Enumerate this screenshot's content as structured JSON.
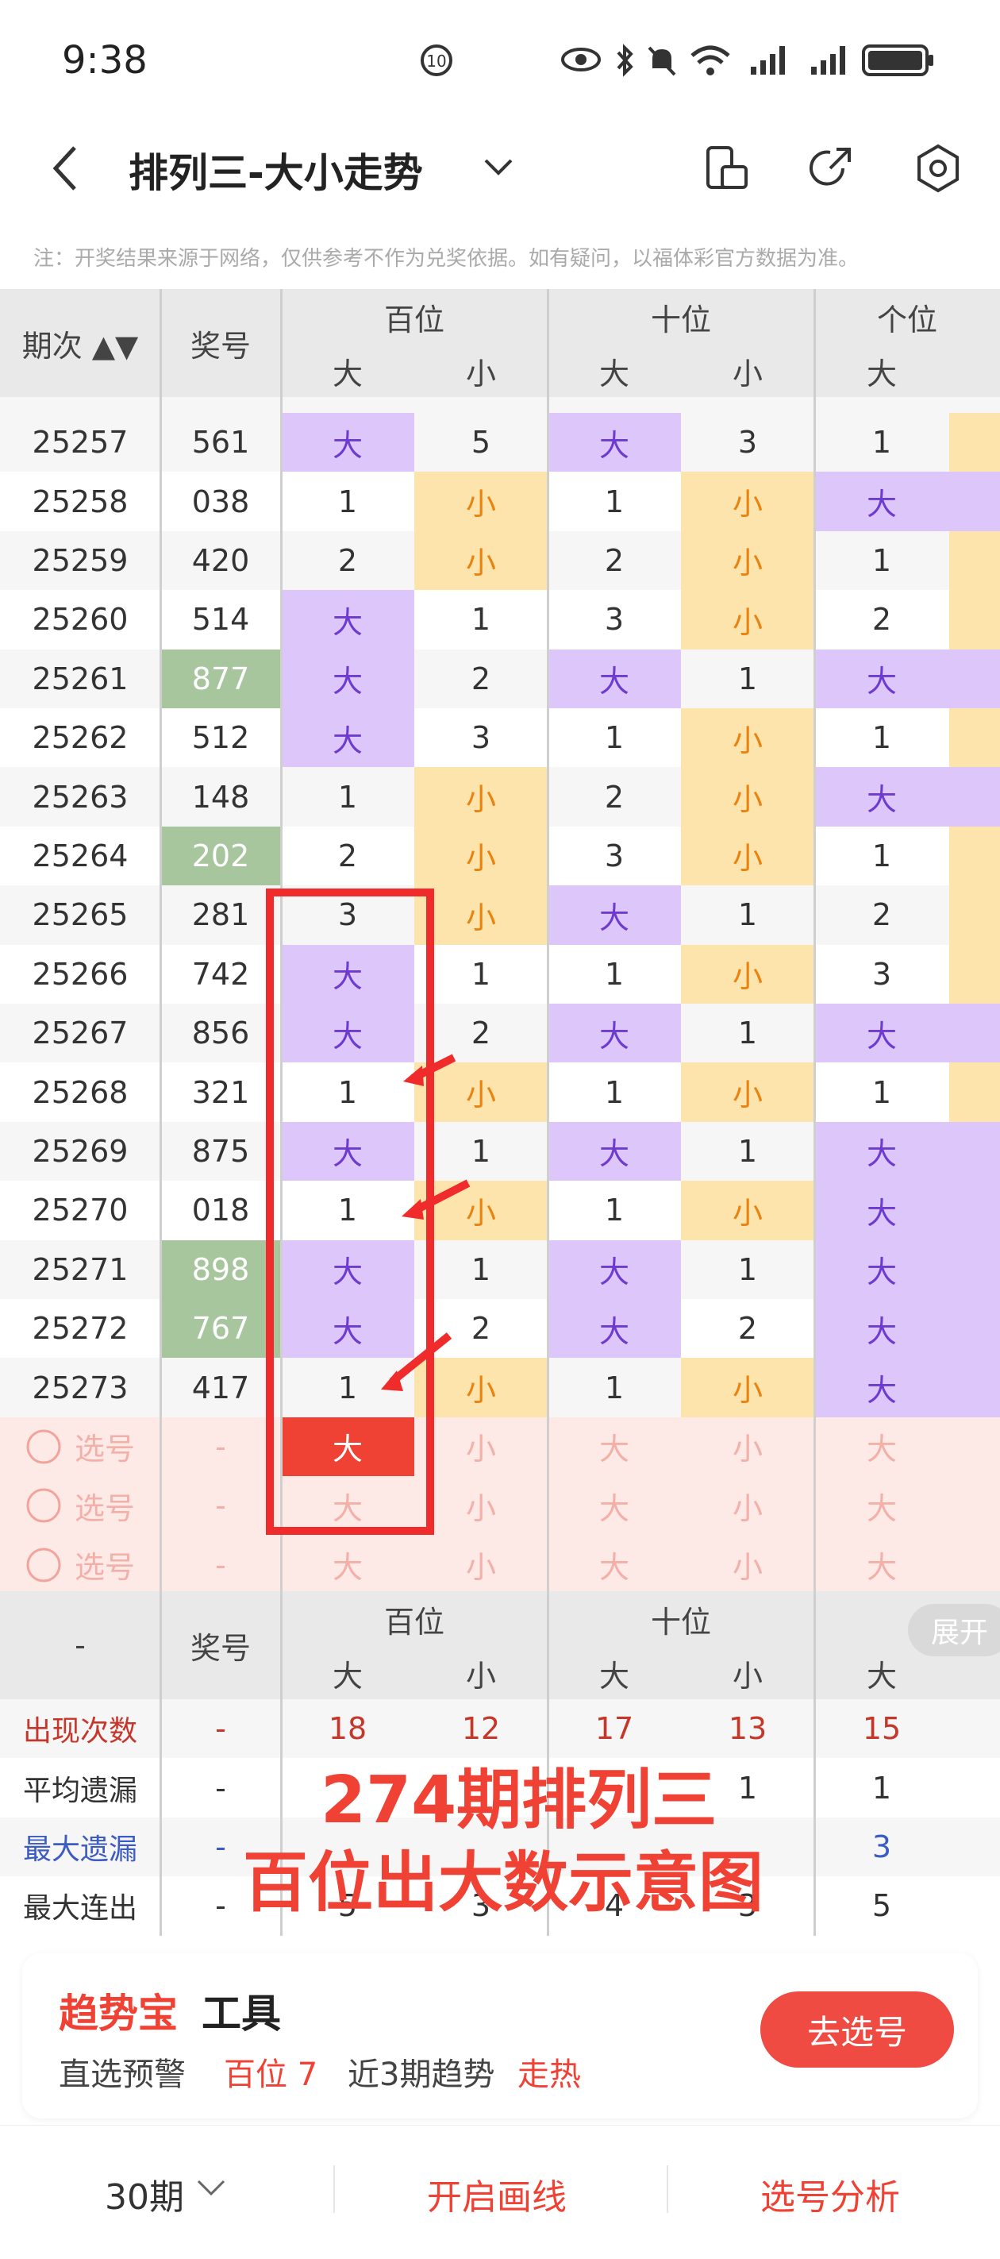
{
  "status_bar": {
    "time": "9:38"
  },
  "nav": {
    "title": "排列三-大小走势"
  },
  "notice": "注：开奖结果来源于网络，仅供参考不作为兑奖依据。如有疑问，以福体彩官方数据为准。",
  "table": {
    "col_issue": "期次",
    "col_award": "奖号",
    "groups": [
      "百位",
      "十位",
      "个位"
    ],
    "big": "大",
    "small": "小",
    "rows": [
      {
        "issue": "25257",
        "award": "561",
        "c": [
          "大",
          "5",
          "大",
          "3",
          "1"
        ],
        "t": [
          "b",
          "n",
          "b",
          "n",
          "n"
        ],
        "g": false
      },
      {
        "issue": "25258",
        "award": "038",
        "c": [
          "1",
          "小",
          "1",
          "小",
          "大"
        ],
        "t": [
          "n",
          "s",
          "n",
          "s",
          "b"
        ],
        "g": false
      },
      {
        "issue": "25259",
        "award": "420",
        "c": [
          "2",
          "小",
          "2",
          "小",
          "1"
        ],
        "t": [
          "n",
          "s",
          "n",
          "s",
          "n"
        ],
        "g": false
      },
      {
        "issue": "25260",
        "award": "514",
        "c": [
          "大",
          "1",
          "3",
          "小",
          "2"
        ],
        "t": [
          "b",
          "n",
          "n",
          "s",
          "n"
        ],
        "g": false
      },
      {
        "issue": "25261",
        "award": "877",
        "c": [
          "大",
          "2",
          "大",
          "1",
          "大"
        ],
        "t": [
          "b",
          "n",
          "b",
          "n",
          "b"
        ],
        "g": true
      },
      {
        "issue": "25262",
        "award": "512",
        "c": [
          "大",
          "3",
          "1",
          "小",
          "1"
        ],
        "t": [
          "b",
          "n",
          "n",
          "s",
          "n"
        ],
        "g": false
      },
      {
        "issue": "25263",
        "award": "148",
        "c": [
          "1",
          "小",
          "2",
          "小",
          "大"
        ],
        "t": [
          "n",
          "s",
          "n",
          "s",
          "b"
        ],
        "g": false
      },
      {
        "issue": "25264",
        "award": "202",
        "c": [
          "2",
          "小",
          "3",
          "小",
          "1"
        ],
        "t": [
          "n",
          "s",
          "n",
          "s",
          "n"
        ],
        "g": true
      },
      {
        "issue": "25265",
        "award": "281",
        "c": [
          "3",
          "小",
          "大",
          "1",
          "2"
        ],
        "t": [
          "n",
          "s",
          "b",
          "n",
          "n"
        ],
        "g": false
      },
      {
        "issue": "25266",
        "award": "742",
        "c": [
          "大",
          "1",
          "1",
          "小",
          "3"
        ],
        "t": [
          "b",
          "n",
          "n",
          "s",
          "n"
        ],
        "g": false
      },
      {
        "issue": "25267",
        "award": "856",
        "c": [
          "大",
          "2",
          "大",
          "1",
          "大"
        ],
        "t": [
          "b",
          "n",
          "b",
          "n",
          "b"
        ],
        "g": false
      },
      {
        "issue": "25268",
        "award": "321",
        "c": [
          "1",
          "小",
          "1",
          "小",
          "1"
        ],
        "t": [
          "n",
          "s",
          "n",
          "s",
          "n"
        ],
        "g": false
      },
      {
        "issue": "25269",
        "award": "875",
        "c": [
          "大",
          "1",
          "大",
          "1",
          "大"
        ],
        "t": [
          "b",
          "n",
          "b",
          "n",
          "b"
        ],
        "g": false
      },
      {
        "issue": "25270",
        "award": "018",
        "c": [
          "1",
          "小",
          "1",
          "小",
          "大"
        ],
        "t": [
          "n",
          "s",
          "n",
          "s",
          "b"
        ],
        "g": false
      },
      {
        "issue": "25271",
        "award": "898",
        "c": [
          "大",
          "1",
          "大",
          "1",
          "大"
        ],
        "t": [
          "b",
          "n",
          "b",
          "n",
          "b"
        ],
        "g": true
      },
      {
        "issue": "25272",
        "award": "767",
        "c": [
          "大",
          "2",
          "大",
          "2",
          "大"
        ],
        "t": [
          "b",
          "n",
          "b",
          "n",
          "b"
        ],
        "g": true
      },
      {
        "issue": "25273",
        "award": "417",
        "c": [
          "1",
          "小",
          "1",
          "小",
          "大"
        ],
        "t": [
          "n",
          "s",
          "n",
          "s",
          "b"
        ],
        "g": false
      }
    ],
    "pick_rows": [
      {
        "label": "选号",
        "dash": "-",
        "c": [
          "大",
          "小",
          "大",
          "小",
          "大"
        ]
      },
      {
        "label": "选号",
        "dash": "-",
        "c": [
          "大",
          "小",
          "大",
          "小",
          "大"
        ]
      },
      {
        "label": "选号",
        "dash": "-",
        "c": [
          "大",
          "小",
          "大",
          "小",
          "大"
        ]
      }
    ]
  },
  "stats": {
    "dash": "-",
    "expand": "展开",
    "rows": [
      {
        "label": "出现次数",
        "v": [
          "-",
          "18",
          "12",
          "17",
          "13",
          "15"
        ],
        "color": "red"
      },
      {
        "label": "平均遗漏",
        "v": [
          "-",
          "",
          "",
          "",
          "1",
          "1"
        ],
        "color": "plain"
      },
      {
        "label": "最大遗漏",
        "v": [
          "-",
          "",
          "",
          "",
          "",
          "3"
        ],
        "color": "blue"
      },
      {
        "label": "最大连出",
        "v": [
          "-",
          "5",
          "3",
          "4",
          "3",
          "5"
        ],
        "color": "plain"
      }
    ]
  },
  "overlay": {
    "line1": "274期排列三",
    "line2": "百位出大数示意图"
  },
  "tool": {
    "brand": "趋势宝",
    "suffix": "工具",
    "alert": "直选预警",
    "pos": "百位 7",
    "trend_label": "近3期趋势",
    "trend_value": "走热",
    "button": "去选号"
  },
  "bottom": {
    "period": "30期",
    "draw": "开启画线",
    "analysis": "选号分析"
  },
  "colors": {
    "big_bg": "#ddc6fa",
    "big_fg": "#6d3bd0",
    "small_bg": "#fde4ad",
    "small_fg": "#e9820f",
    "accent_red": "#ef4134"
  }
}
